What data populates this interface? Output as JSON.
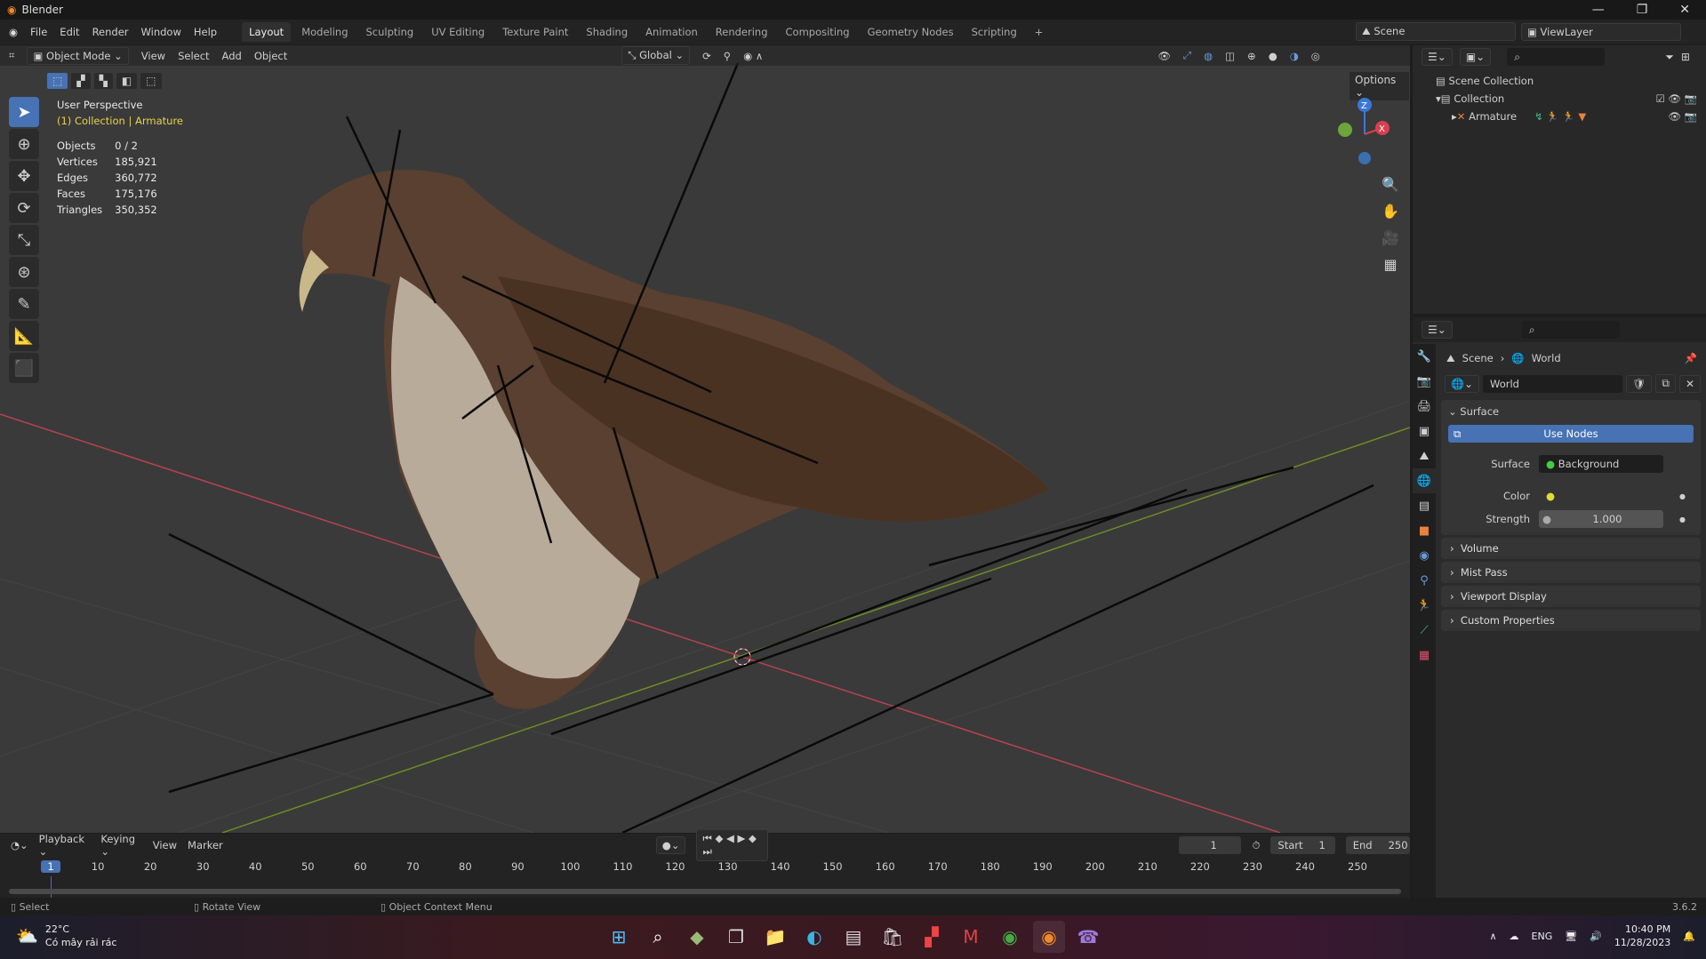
{
  "window": {
    "title": "Blender",
    "min": "—",
    "max": "❐",
    "close": "✕"
  },
  "menu": [
    "File",
    "Edit",
    "Render",
    "Window",
    "Help"
  ],
  "workspaces": [
    "Layout",
    "Modeling",
    "Sculpting",
    "UV Editing",
    "Texture Paint",
    "Shading",
    "Animation",
    "Rendering",
    "Compositing",
    "Geometry Nodes",
    "Scripting",
    "+"
  ],
  "scene": {
    "name": "Scene",
    "view_layer": "ViewLayer"
  },
  "viewport": {
    "mode": "Object Mode",
    "menus": [
      "View",
      "Select",
      "Add",
      "Object"
    ],
    "orientation": "Global",
    "options": "Options",
    "perspective": "User Perspective",
    "context": "(1) Collection | Armature",
    "stats": [
      [
        "Objects",
        "0 / 2"
      ],
      [
        "Vertices",
        "185,921"
      ],
      [
        "Edges",
        "360,772"
      ],
      [
        "Faces",
        "175,176"
      ],
      [
        "Triangles",
        "350,352"
      ]
    ],
    "gizmo": {
      "z": "Z",
      "x": "X"
    }
  },
  "outliner": {
    "items": [
      {
        "label": "Scene Collection"
      },
      {
        "label": "Collection"
      },
      {
        "label": "Armature"
      }
    ]
  },
  "properties": {
    "breadcrumb": [
      "Scene",
      "World"
    ],
    "world_name": "World",
    "surface_header": "Surface",
    "use_nodes": "Use Nodes",
    "surface_label": "Surface",
    "surface_value": "Background",
    "color_label": "Color",
    "strength_label": "Strength",
    "strength_value": "1.000",
    "panels": [
      "Volume",
      "Mist Pass",
      "Viewport Display",
      "Custom Properties"
    ]
  },
  "timeline": {
    "menus": [
      "Playback",
      "Keying",
      "View",
      "Marker"
    ],
    "current_frame": "1",
    "start_label": "Start",
    "start": "1",
    "end_label": "End",
    "end": "250",
    "ticks": [
      "1",
      "10",
      "20",
      "30",
      "40",
      "50",
      "60",
      "70",
      "80",
      "90",
      "100",
      "110",
      "120",
      "130",
      "140",
      "150",
      "160",
      "170",
      "180",
      "190",
      "200",
      "210",
      "220",
      "230",
      "240",
      "250"
    ]
  },
  "status": {
    "select": "Select",
    "rotate": "Rotate View",
    "context": "Object Context Menu",
    "version": "3.6.2"
  },
  "taskbar": {
    "temp": "22°C",
    "weather": "Có mây rải rác",
    "lang": "ENG",
    "time": "10:40 PM",
    "date": "11/28/2023"
  },
  "colors": {
    "accent": "#4772b3",
    "context_yellow": "#e6d24a",
    "x_axis": "#b8434e",
    "y_axis": "#6b8e23"
  }
}
